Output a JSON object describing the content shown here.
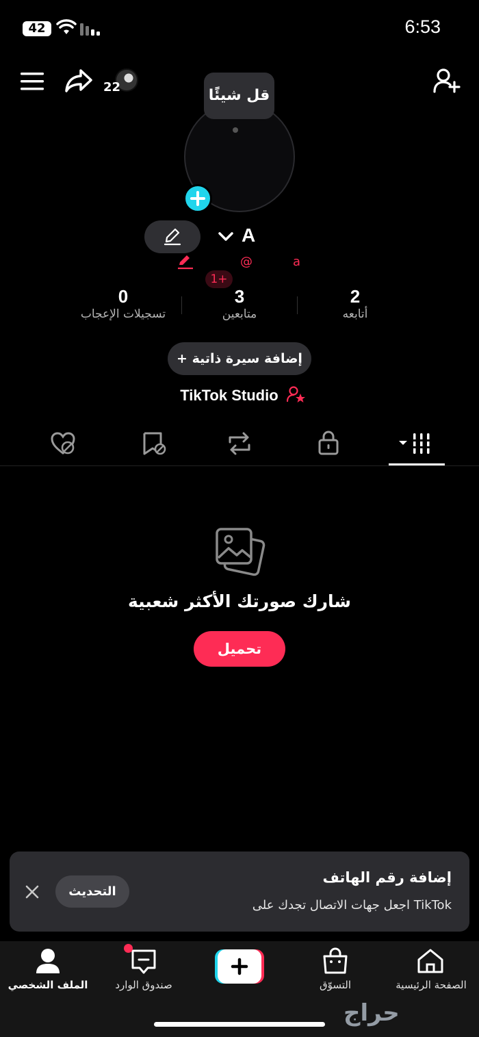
{
  "status_bar": {
    "battery": "42",
    "time": "6:53"
  },
  "top_bar": {
    "friends_count": "22"
  },
  "profile": {
    "bubble_text": "قل شيئًا",
    "username": "A",
    "handle_prefix": "@",
    "handle": "a",
    "new_badge": "1+"
  },
  "stats": [
    {
      "value": "2",
      "label": "أتابعه"
    },
    {
      "value": "3",
      "label": "متابعين"
    },
    {
      "value": "0",
      "label": "تسجيلات الإعجاب"
    }
  ],
  "bio_button": "+ إضافة سيرة ذاتية",
  "studio_label": "TikTok Studio",
  "tabs": [
    "videos",
    "private",
    "reposts",
    "favorites",
    "liked"
  ],
  "empty_state": {
    "title": "شارك صورتك الأكثر شعبية",
    "button": "تحميل"
  },
  "phone_card": {
    "title": "إضافة رقم الهاتف",
    "subtitle": "اجعل جهات الاتصال تجدك على TikTok",
    "update_button": "التحديث"
  },
  "bottom_nav": {
    "home": "الصفحة الرئيسية",
    "shop": "التسوّق",
    "inbox": "صندوق الوارد",
    "profile": "الملف الشخصي"
  },
  "watermark": "حراج",
  "colors": {
    "accent": "#fe2c55",
    "cyan": "#20d5ec"
  }
}
